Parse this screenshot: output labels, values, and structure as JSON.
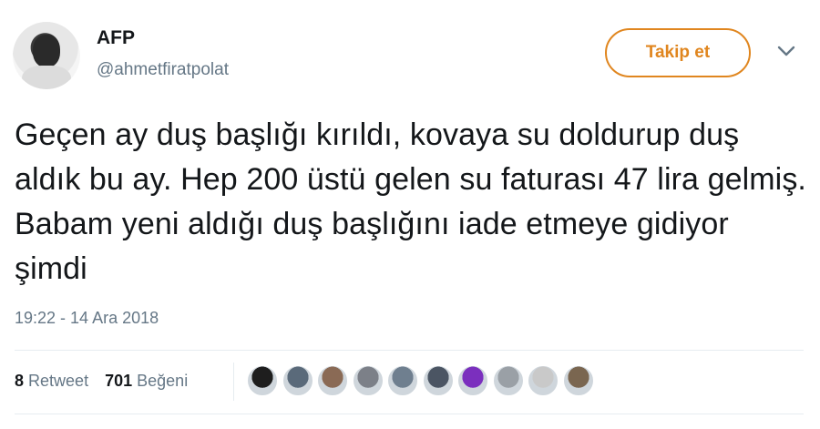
{
  "header": {
    "display_name": "AFP",
    "handle": "@ahmetfiratpolat",
    "follow_label": "Takip et"
  },
  "tweet": {
    "text": "Geçen ay duş başlığı kırıldı, kovaya su doldurup duş aldık bu ay. Hep 200 üstü gelen su faturası 47 lira gelmiş. Babam yeni aldığı duş başlığını iade etmeye gidiyor şimdi",
    "timestamp": "19:22 - 14 Ara 2018"
  },
  "stats": {
    "retweet_count": "8",
    "retweet_label": "Retweet",
    "like_count": "701",
    "like_label": "Beğeni"
  },
  "colors": {
    "accent": "#e0861f",
    "secondary_text": "#657786"
  },
  "likers": [
    {
      "color": "#1e1e1e"
    },
    {
      "color": "#5a6a7a"
    },
    {
      "color": "#8a6a55"
    },
    {
      "color": "#7c8088"
    },
    {
      "color": "#6f7f8f"
    },
    {
      "color": "#4b5563"
    },
    {
      "color": "#7b2fbe"
    },
    {
      "color": "#9aa0a6"
    },
    {
      "color": "#c9c9c9"
    },
    {
      "color": "#7a6650"
    }
  ]
}
